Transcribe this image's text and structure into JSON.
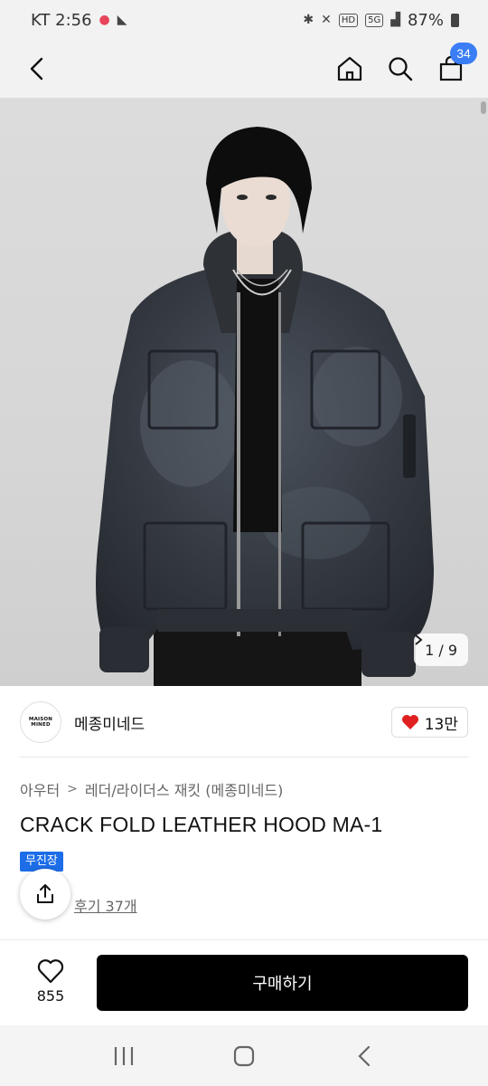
{
  "status_bar": {
    "time": "KT 2:56",
    "battery": "87%",
    "icons": [
      "notification-icon",
      "volte-icon",
      "bluetooth-icon",
      "mute-icon",
      "hd-icon",
      "5g-icon",
      "signal-icon",
      "battery-icon"
    ],
    "hd_label": "HD",
    "net_label": "5G"
  },
  "app_bar": {
    "cart_count": "34",
    "icons": [
      "back-icon",
      "home-icon",
      "search-icon",
      "cart-icon"
    ]
  },
  "gallery": {
    "counter": "1 / 9"
  },
  "brand": {
    "logo_text": "MAISON MINED",
    "name": "메종미네드",
    "likes": "13만",
    "heart_color": "#e02020"
  },
  "breadcrumb": {
    "category": "아우터",
    "subcategory": "레더/라이더스 재킷 (메종미네드)"
  },
  "product": {
    "title": "CRACK FOLD LEATHER HOOD MA-1",
    "badge": "무진장",
    "badge_color": "#1d6de8",
    "reviews": "후기 37개"
  },
  "bottom": {
    "wish_count": "855",
    "buy_label": "구매하기"
  },
  "nav_bar": {
    "icons": [
      "recents-icon",
      "home-nav-icon",
      "back-nav-icon"
    ]
  }
}
